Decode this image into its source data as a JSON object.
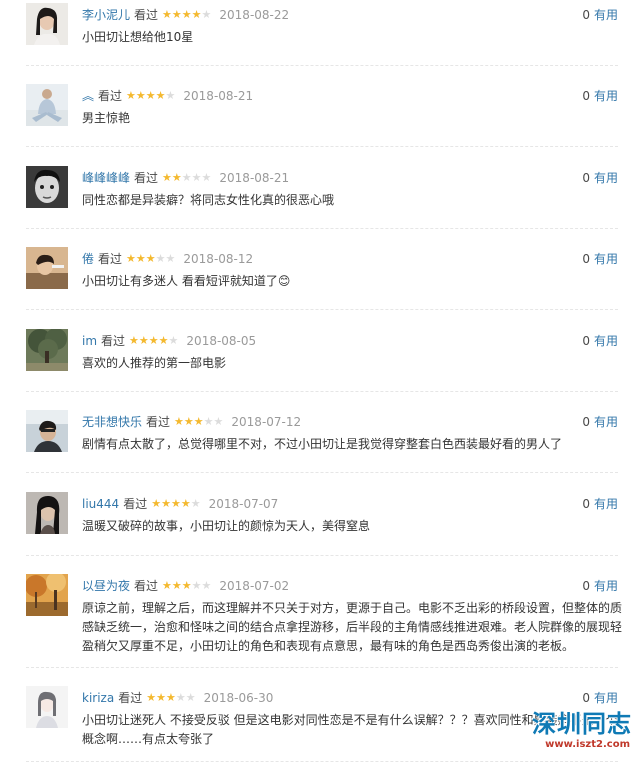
{
  "comments": [
    {
      "author": "李小泥儿",
      "watched": "看过",
      "rating": 4,
      "date": "2018-08-22",
      "votes": "0",
      "useful_label": "有用",
      "content": "小田切让想给他10星",
      "avatar_icon": "avatar-photo-woman"
    },
    {
      "author": "",
      "watched": "看过",
      "rating": 4,
      "date": "2018-08-21",
      "votes": "0",
      "useful_label": "有用",
      "content": "男主惊艳",
      "avatar_icon": "avatar-photo-person-sitting"
    },
    {
      "author": "峰峰峰峰",
      "watched": "看过",
      "rating": 2,
      "date": "2018-08-21",
      "votes": "0",
      "useful_label": "有用",
      "content": "同性恋都是异装癖？将同志女性化真的很恶心哦",
      "avatar_icon": "avatar-photo-bw-face"
    },
    {
      "author": "倦",
      "watched": "看过",
      "rating": 3,
      "date": "2018-08-12",
      "votes": "0",
      "useful_label": "有用",
      "content": "小田切让有多迷人 看看短评就知道了😊",
      "avatar_icon": "avatar-photo-warm"
    },
    {
      "author": "im",
      "watched": "看过",
      "rating": 4,
      "date": "2018-08-05",
      "votes": "0",
      "useful_label": "有用",
      "content": "喜欢的人推荐的第一部电影",
      "avatar_icon": "avatar-photo-tree"
    },
    {
      "author": "无非想快乐",
      "watched": "看过",
      "rating": 3,
      "date": "2018-07-12",
      "votes": "0",
      "useful_label": "有用",
      "content": "剧情有点太散了，总觉得哪里不对，不过小田切让是我觉得穿整套白色西装最好看的男人了",
      "avatar_icon": "avatar-photo-car-selfie"
    },
    {
      "author": "liu444",
      "watched": "看过",
      "rating": 4,
      "date": "2018-07-07",
      "votes": "0",
      "useful_label": "有用",
      "content": "温暖又破碎的故事，小田切让的颜惊为天人，美得窒息",
      "avatar_icon": "avatar-photo-dark-hair"
    },
    {
      "author": "以昼为夜",
      "watched": "看过",
      "rating": 3,
      "date": "2018-07-02",
      "votes": "0",
      "useful_label": "有用",
      "content": "原谅之前，理解之后，而这理解并不只关于对方，更源于自己。电影不乏出彩的桥段设置，但整体的质感缺乏统一，治愈和怪味之间的结合点拿捏游移，后半段的主角情感线推进艰难。老人院群像的展现轻盈稍欠又厚重不足，小田切让的角色和表现有点意思，最有味的角色是西岛秀俊出演的老板。",
      "avatar_icon": "avatar-photo-autumn"
    },
    {
      "author": "kiriza",
      "watched": "看过",
      "rating": 3,
      "date": "2018-06-30",
      "votes": "0",
      "useful_label": "有用",
      "content": "小田切让迷死人 不接受反驳 但是这电影对同性恋是不是有什么误解？？？喜欢同性和异装癖不是一个概念啊……有点太夸张了",
      "avatar_icon": "avatar-photo-sketch-girl"
    }
  ],
  "watermark": {
    "title": "深圳同志",
    "url": "www.iszt2.com"
  },
  "colors": {
    "link": "#3377aa",
    "star_on": "#f4b92f",
    "star_off": "#dcdcdc",
    "date": "#9a9a9a",
    "watermark": "#0f7ab5"
  }
}
